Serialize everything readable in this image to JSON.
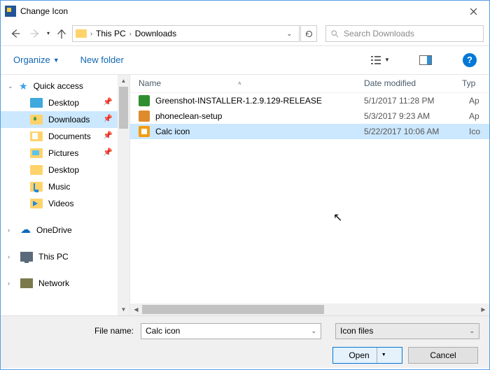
{
  "window": {
    "title": "Change Icon"
  },
  "breadcrumb": {
    "root_sep": "›",
    "crumb1": "This PC",
    "sep": "›",
    "crumb2": "Downloads"
  },
  "search": {
    "placeholder": "Search Downloads"
  },
  "toolbar": {
    "organize": "Organize",
    "newfolder": "New folder",
    "help": "?"
  },
  "nav": {
    "quick": "Quick access",
    "desktop": "Desktop",
    "downloads": "Downloads",
    "documents": "Documents",
    "pictures": "Pictures",
    "desktop2": "Desktop",
    "music": "Music",
    "videos": "Videos",
    "onedrive": "OneDrive",
    "thispc": "This PC",
    "network": "Network"
  },
  "columns": {
    "name": "Name",
    "date": "Date modified",
    "type": "Typ"
  },
  "files": {
    "f0": {
      "name": "Greenshot-INSTALLER-1.2.9.129-RELEASE",
      "date": "5/1/2017 11:28 PM",
      "type": "Ap"
    },
    "f1": {
      "name": "phoneclean-setup",
      "date": "5/3/2017 9:23 AM",
      "type": "Ap"
    },
    "f2": {
      "name": "Calc icon",
      "date": "5/22/2017 10:06 AM",
      "type": "Ico"
    }
  },
  "footer": {
    "filename_label": "File name:",
    "filename_value": "Calc icon",
    "filter_value": "Icon files",
    "open": "Open",
    "cancel": "Cancel"
  }
}
